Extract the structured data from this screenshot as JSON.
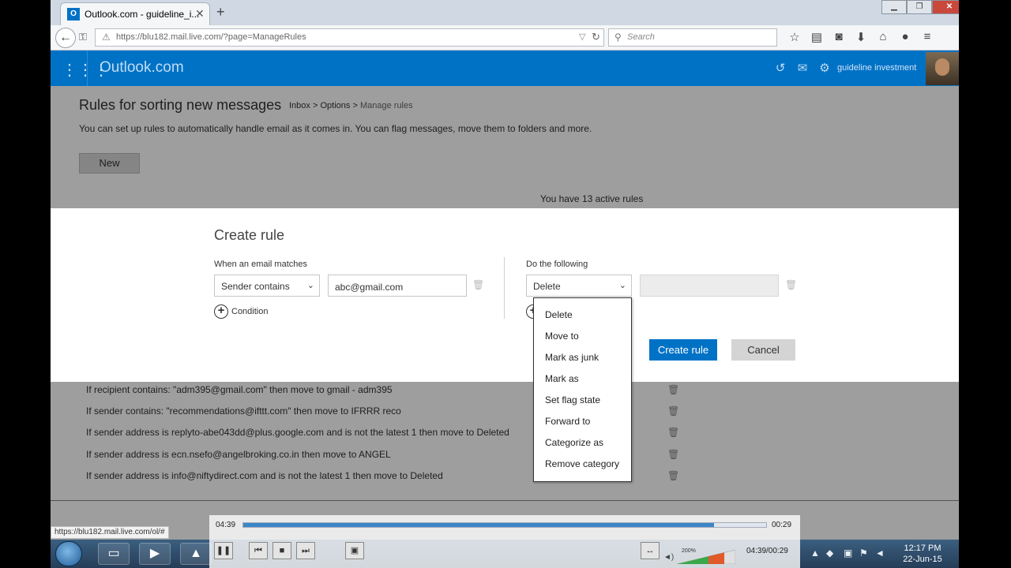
{
  "browser": {
    "tab_title": "Outlook.com - guideline_i...",
    "url": "https://blu182.mail.live.com/?page=ManageRules",
    "search_placeholder": "Search",
    "status_link": "https://blu182.mail.live.com/ol/#"
  },
  "outlook": {
    "brand": "Outlook.com",
    "user_name": "guideline investment"
  },
  "page": {
    "title": "Rules for sorting new messages",
    "breadcrumb": [
      "Inbox",
      ">",
      "Options",
      ">",
      "Manage rules"
    ],
    "description": "You can set up rules to automatically handle email as it comes in. You can flag messages, move them to folders and more.",
    "new_label": "New",
    "active_rules": "You have 13 active rules",
    "rules": [
      "If recipient contains: \"adm395@gmail.com\" then move to gmail - adm395",
      "If sender contains: \"recommendations@ifttt.com\" then move to IFRRR reco",
      "If sender address is replyto-abe043dd@plus.google.com and is not the latest 1 then move to Deleted",
      "If sender address is ecn.nsefo@angelbroking.co.in then move to ANGEL",
      "If sender address is info@niftydirect.com and is not the latest 1 then move to Deleted"
    ]
  },
  "dialog": {
    "title": "Create rule",
    "when_label": "When an email matches",
    "condition_select": "Sender contains",
    "condition_value": "abc@gmail.com",
    "add_condition": "Condition",
    "do_label": "Do the following",
    "action_select": "Delete",
    "create_label": "Create rule",
    "cancel_label": "Cancel",
    "action_options": [
      "Delete",
      "Move to",
      "Mark as junk",
      "Mark as",
      "Set flag state",
      "Forward to",
      "Categorize as",
      "Remove category"
    ]
  },
  "player": {
    "elapsed": "04:39",
    "remaining": "00:29",
    "counter": "04:39/00:29",
    "volume": "200%",
    "progress": 0.9
  },
  "taskbar": {
    "time": "12:17 PM",
    "date": "22-Jun-15"
  },
  "colors": {
    "accent": "#0072c6"
  }
}
